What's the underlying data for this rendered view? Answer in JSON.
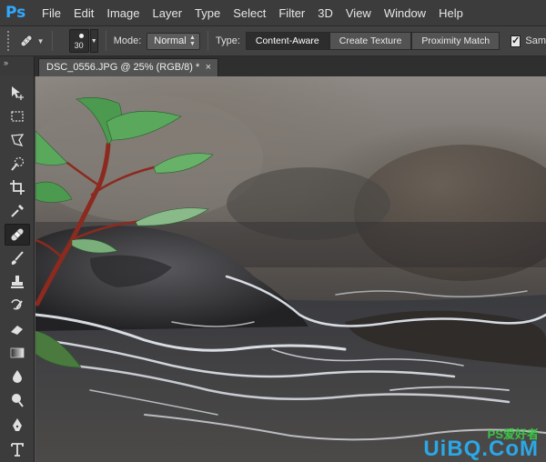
{
  "app": {
    "logo": "Ps"
  },
  "menu": [
    "File",
    "Edit",
    "Image",
    "Layer",
    "Type",
    "Select",
    "Filter",
    "3D",
    "View",
    "Window",
    "Help"
  ],
  "options": {
    "brush_size": "30",
    "mode_label": "Mode:",
    "mode_value": "Normal",
    "type_label": "Type:",
    "type_options": [
      "Content-Aware",
      "Create Texture",
      "Proximity Match"
    ],
    "type_selected": "Content-Aware",
    "sample_label": "Sam"
  },
  "document": {
    "tab_title": "DSC_0556.JPG @ 25% (RGB/8) *",
    "close_glyph": "×"
  },
  "toolbar": {
    "collapse_glyph": "»",
    "tools": [
      "move",
      "marquee",
      "lasso",
      "quick-selection",
      "crop",
      "eyedropper",
      "spot-healing-brush",
      "brush",
      "clone-stamp",
      "history-brush",
      "eraser",
      "gradient",
      "blur",
      "dodge",
      "pen",
      "type"
    ],
    "active_tool": "spot-healing-brush"
  },
  "watermark": {
    "top_text": "PS爱好者",
    "main_text": "UiBQ.CoM"
  },
  "colors": {
    "ps_blue": "#31a8ff",
    "ui_dark": "#3c3c3c",
    "watermark_green": "#3ec24a",
    "watermark_blue": "#2aa8e8"
  }
}
